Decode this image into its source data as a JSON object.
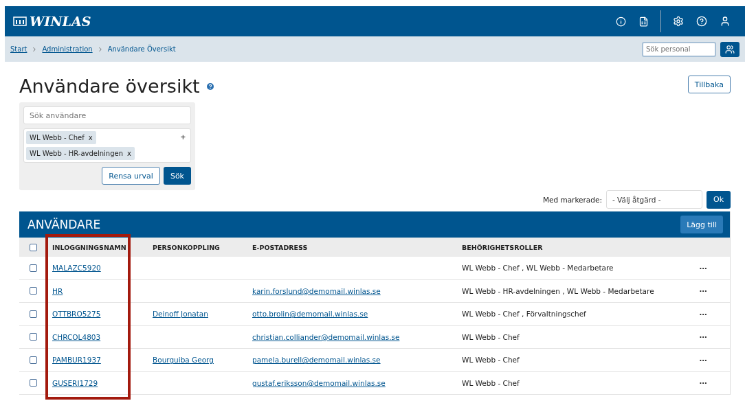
{
  "app": {
    "logo": "WINLAS"
  },
  "breadcrumb": [
    {
      "label": "Start",
      "link": true
    },
    {
      "label": "Administration",
      "link": true
    },
    {
      "label": "Användare Översikt",
      "link": false
    }
  ],
  "staff_search": {
    "placeholder": "Sök personal"
  },
  "page": {
    "title": "Användare översikt",
    "back_button": "Tillbaka"
  },
  "filter": {
    "search_placeholder": "Sök användare",
    "tags": [
      {
        "label": "WL Webb - Chef",
        "remove_symbol": "x"
      },
      {
        "label": "WL Webb - HR-avdelningen",
        "remove_symbol": "x"
      }
    ],
    "add_symbol": "+",
    "clear_button": "Rensa urval",
    "search_button": "Sök"
  },
  "bulk_action": {
    "label": "Med markerade:",
    "select_value": "- Välj åtgärd -",
    "ok_button": "Ok"
  },
  "table": {
    "title": "ANVÄNDARE",
    "add_button": "Lägg till",
    "first_column_highlighted": true,
    "select_all_checked": false,
    "columns": [
      "INLOGGNINGSNAMN",
      "PERSONKOPPLING",
      "E-POSTADRESS",
      "BEHÖRIGHETSROLLER"
    ],
    "menu_symbol": "•••",
    "rows": [
      {
        "checked": false,
        "login": "MALAZC5920",
        "person": "",
        "email": "",
        "roles": "WL Webb - Chef , WL Webb - Medarbetare"
      },
      {
        "checked": false,
        "login": "HR",
        "person": "",
        "email": "karin.forslund@demomail.winlas.se",
        "roles": "WL Webb - HR-avdelningen , WL Webb - Medarbetare"
      },
      {
        "checked": false,
        "login": "OTTBRO5275",
        "person": "Deinoff Jonatan",
        "email": "otto.brolin@demomail.winlas.se",
        "roles": "WL Webb - Chef , Förvaltningschef"
      },
      {
        "checked": false,
        "login": "CHRCOL4803",
        "person": "",
        "email": "christian.colliander@demomail.winlas.se",
        "roles": "WL Webb - Chef"
      },
      {
        "checked": false,
        "login": "PAMBUR1937",
        "person": "Bourguiba Georg",
        "email": "pamela.burell@demomail.winlas.se",
        "roles": "WL Webb - Chef"
      },
      {
        "checked": false,
        "login": "GUSERI1729",
        "person": "",
        "email": "gustaf.eriksson@demomail.winlas.se",
        "roles": "WL Webb - Chef"
      }
    ]
  }
}
